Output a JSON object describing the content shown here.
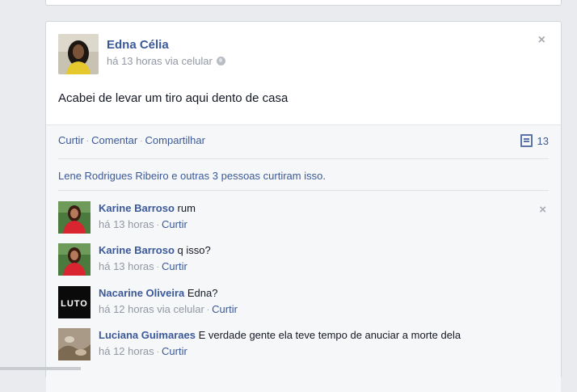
{
  "post": {
    "author": "Edna Célia",
    "timestamp": "há 13 horas via celular",
    "privacy_icon": "globe-icon",
    "text": "Acabei de levar um tiro aqui dento de casa",
    "close_icon": "×"
  },
  "actions": {
    "like": "Curtir",
    "comment": "Comentar",
    "share": "Compartilhar",
    "separator": "·",
    "comment_count": "13"
  },
  "likes_text": "Lene Rodrigues Ribeiro e outras 3 pessoas curtiram isso.",
  "comments": [
    {
      "author": "Karine Barroso",
      "text": "rum",
      "time": "há 13 horas",
      "like": "Curtir",
      "sep": "·"
    },
    {
      "author": "Karine Barroso",
      "text": "q isso?",
      "time": "há 13 horas",
      "like": "Curtir",
      "sep": "·"
    },
    {
      "author": "Nacarine Oliveira",
      "text": "Edna?",
      "time": "há 12 horas via celular",
      "like": "Curtir",
      "sep": "·",
      "avatar_text": "LUTO"
    },
    {
      "author": "Luciana Guimaraes",
      "text": "E verdade gente ela teve tempo de anuciar a morte dela",
      "time": "há 12 horas",
      "like": "Curtir",
      "sep": "·"
    }
  ],
  "comment_close_icon": "×",
  "colors": {
    "link": "#3b5998",
    "meta": "#9197a3",
    "background": "#e9ebee"
  }
}
